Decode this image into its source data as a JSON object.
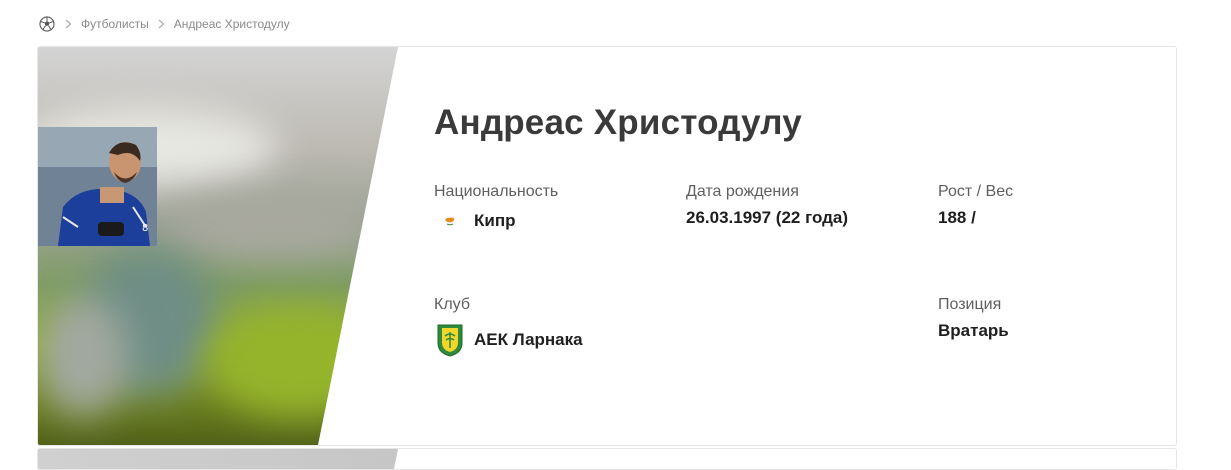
{
  "breadcrumb": {
    "home_icon": "soccer-ball-icon",
    "items": [
      "Футболисты",
      "Андреас Христодулу"
    ]
  },
  "player": {
    "name": "Андреас Христодулу",
    "nationality_label": "Национальность",
    "nationality": "Кипр",
    "birth_label": "Дата рождения",
    "birth": "26.03.1997 (22 года)",
    "height_weight_label": "Рост / Вес",
    "height_weight": "188 /",
    "club_label": "Клуб",
    "club": "АЕК Ларнака",
    "position_label": "Позиция",
    "position": "Вратарь"
  },
  "colors": {
    "name_text": "#3a3a3a",
    "label_text": "#5f5f5f",
    "value_text": "#1f1f1f",
    "club_green": "#2f8a3c",
    "club_yellow": "#f2d72a",
    "flag_orange": "#e58c1a"
  }
}
